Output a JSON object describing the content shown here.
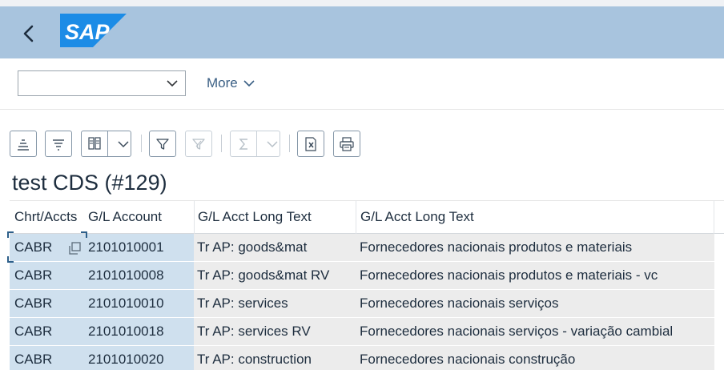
{
  "shell": {
    "logo_text": "SAP",
    "back_icon": "chevron-left-icon",
    "colors": {
      "shellbar": "#a8c4de",
      "logo": "#1c8ce6",
      "accent_link": "#3a5f84"
    }
  },
  "filter_bar": {
    "variant_value": "",
    "more_label": "More"
  },
  "table_toolbar": {
    "buttons": [
      {
        "icon": "sort-ascending-icon",
        "enabled": true
      },
      {
        "icon": "filter-list-icon",
        "enabled": true
      },
      {
        "icon": "column-settings-icon",
        "enabled": true,
        "has_dropdown": true
      },
      {
        "icon": "filter-icon",
        "enabled": true
      },
      {
        "icon": "clear-filter-icon",
        "enabled": false
      },
      {
        "icon": "sum-icon",
        "enabled": false,
        "has_dropdown": true
      },
      {
        "icon": "export-excel-icon",
        "enabled": true
      },
      {
        "icon": "print-icon",
        "enabled": true
      }
    ]
  },
  "report": {
    "title": "test CDS (#129)",
    "columns": [
      "Chrt/Accts",
      "G/L Account",
      "G/L Acct Long Text",
      "G/L Acct Long Text"
    ],
    "rows": [
      [
        "CABR",
        "2101010001",
        "Tr AP: goods&mat",
        "Fornecedores nacionais produtos e materiais"
      ],
      [
        "CABR",
        "2101010008",
        "Tr AP: goods&mat RV",
        "Fornecedores nacionais produtos e materiais - vc"
      ],
      [
        "CABR",
        "2101010010",
        "Tr AP: services",
        "Fornecedores nacionais serviços"
      ],
      [
        "CABR",
        "2101010018",
        "Tr AP: services RV",
        "Fornecedores nacionais serviços - variação cambial"
      ],
      [
        "CABR",
        "2101010020",
        "Tr AP: construction",
        "Fornecedores nacionais construção"
      ]
    ]
  }
}
